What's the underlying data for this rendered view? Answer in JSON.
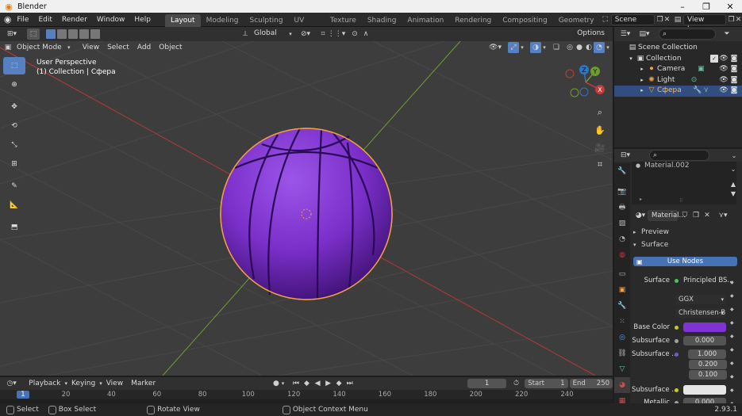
{
  "window": {
    "title": "Blender",
    "version": "2.93.1"
  },
  "topmenu": {
    "items": [
      "File",
      "Edit",
      "Render",
      "Window",
      "Help"
    ]
  },
  "workspaces": [
    "Layout",
    "Modeling",
    "Sculpting",
    "UV Editing",
    "Texture Paint",
    "Shading",
    "Animation",
    "Rendering",
    "Compositing",
    "Geometry Nod"
  ],
  "scene": {
    "name": "Scene",
    "view_layer": "View Layer"
  },
  "header": {
    "orientation": "Global",
    "options": "Options",
    "mode": "Object Mode",
    "menus": [
      "View",
      "Select",
      "Add",
      "Object"
    ]
  },
  "viewport": {
    "overlay_line1": "User Perspective",
    "overlay_line2": "(1) Collection | Сфера",
    "gizmo": {
      "z": "Z",
      "y": "Y",
      "x": "X"
    },
    "sphere_color": "#7a2fc9",
    "outline_color": "#f0a040"
  },
  "outliner": {
    "rows": [
      {
        "label": "Scene Collection",
        "depth": 0
      },
      {
        "label": "Collection",
        "depth": 1
      },
      {
        "label": "Camera",
        "depth": 2
      },
      {
        "label": "Light",
        "depth": 2
      },
      {
        "label": "Сфера",
        "depth": 2,
        "selected": true
      }
    ]
  },
  "properties": {
    "material_slot": "Material.002",
    "material_name": "Material...",
    "sections": {
      "preview": "Preview",
      "surface": "Surface"
    },
    "use_nodes": "Use Nodes",
    "surface_label": "Surface",
    "surface_value": "Principled BS...",
    "distribution": "GGX",
    "subsurface_method": "Christensen-B...",
    "base_color_label": "Base Color",
    "base_color": "#8033d4",
    "subsurface_label": "Subsurface",
    "subsurface_value": "0.000",
    "subsurface_radius_label": "Subsurface ...",
    "subsurface_radius": [
      "1.000",
      "0.200",
      "0.100"
    ],
    "subsurface_color_label": "Subsurface ...",
    "metallic_label": "Metallic",
    "metallic_value": "0.000"
  },
  "timeline": {
    "menus": [
      "Playback",
      "Keying",
      "View",
      "Marker"
    ],
    "current_frame": "1",
    "start_label": "Start",
    "start": "1",
    "end_label": "End",
    "end": "250",
    "ruler": [
      "1",
      "20",
      "40",
      "60",
      "80",
      "100",
      "120",
      "140",
      "160",
      "180",
      "200",
      "220",
      "240"
    ]
  },
  "statusbar": {
    "select": "Select",
    "box_select": "Box Select",
    "rotate_view": "Rotate View",
    "context_menu": "Object Context Menu",
    "version": "2.93.1"
  }
}
